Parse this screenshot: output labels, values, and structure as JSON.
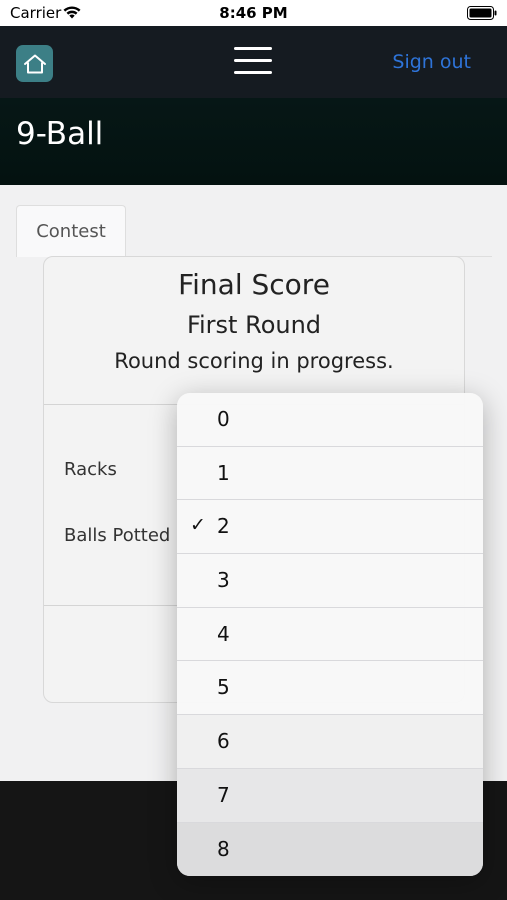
{
  "status_bar": {
    "carrier": "Carrier",
    "time": "8:46 PM"
  },
  "navbar": {
    "signout_label": "Sign out",
    "home_icon": "home-icon",
    "menu_icon": "menu-icon"
  },
  "page": {
    "title": "9-Ball"
  },
  "tabs": [
    {
      "label": "Contest"
    }
  ],
  "card": {
    "title": "Final Score",
    "subtitle": "First Round",
    "status": "Round scoring in progress.",
    "fields": [
      {
        "label": "Racks"
      },
      {
        "label": "Balls Potted"
      }
    ]
  },
  "picker": {
    "selected": "2",
    "check_mark": "✓",
    "options": [
      "0",
      "1",
      "2",
      "3",
      "4",
      "5",
      "6",
      "7",
      "8"
    ]
  },
  "colors": {
    "navbar": "#151b21",
    "home_button": "#3c7f86",
    "link": "#2e74d9",
    "title_band": "#061716"
  }
}
